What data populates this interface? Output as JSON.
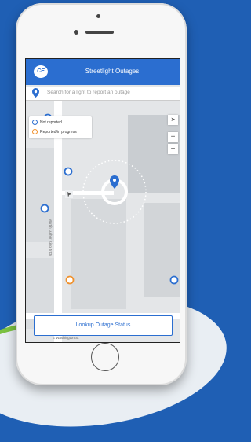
{
  "app": {
    "title": "Streetlight Outages",
    "logo_text": "CE"
  },
  "search": {
    "placeholder": "Search for a light to report an outage"
  },
  "legend": {
    "items": [
      {
        "label": "Not reported",
        "color": "#2b6ed0"
      },
      {
        "label": "Reported/in progress",
        "color": "#f0912d"
      }
    ]
  },
  "map_controls": {
    "locate": "➤",
    "zoom_in": "+",
    "zoom_out": "−"
  },
  "streets": {
    "vertical": "Martin Luther King Jr Dr",
    "horizontal": "E Washington St"
  },
  "actions": {
    "lookup_label": "Lookup Outage Status"
  },
  "colors": {
    "accent": "#2b6ed0",
    "reported": "#f0912d"
  }
}
